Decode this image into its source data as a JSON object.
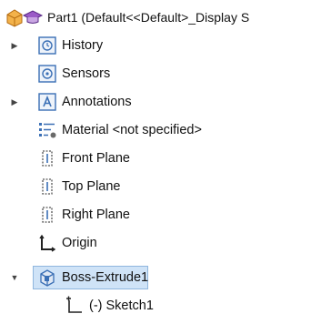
{
  "part": {
    "title": "Part1  (Default<<Default>_Display S"
  },
  "tree": {
    "items": [
      {
        "label": "History",
        "expandable": true,
        "icon": "history-icon"
      },
      {
        "label": "Sensors",
        "expandable": false,
        "icon": "sensors-icon"
      },
      {
        "label": "Annotations",
        "expandable": true,
        "icon": "annotations-icon"
      },
      {
        "label": "Material <not specified>",
        "expandable": false,
        "icon": "material-icon"
      },
      {
        "label": "Front Plane",
        "expandable": false,
        "icon": "plane-icon"
      },
      {
        "label": "Top Plane",
        "expandable": false,
        "icon": "plane-icon"
      },
      {
        "label": "Right Plane",
        "expandable": false,
        "icon": "plane-icon"
      },
      {
        "label": "Origin",
        "expandable": false,
        "icon": "origin-icon"
      },
      {
        "label": "Boss-Extrude1",
        "expandable": true,
        "expanded": true,
        "selected": true,
        "icon": "boss-extrude-icon"
      },
      {
        "label": "(-) Sketch1",
        "expandable": false,
        "icon": "sketch-icon"
      }
    ]
  },
  "colors": {
    "selection": "#cfe3f7",
    "icon_blue": "#3a6fb5",
    "part_orange": "#e58a1f"
  }
}
